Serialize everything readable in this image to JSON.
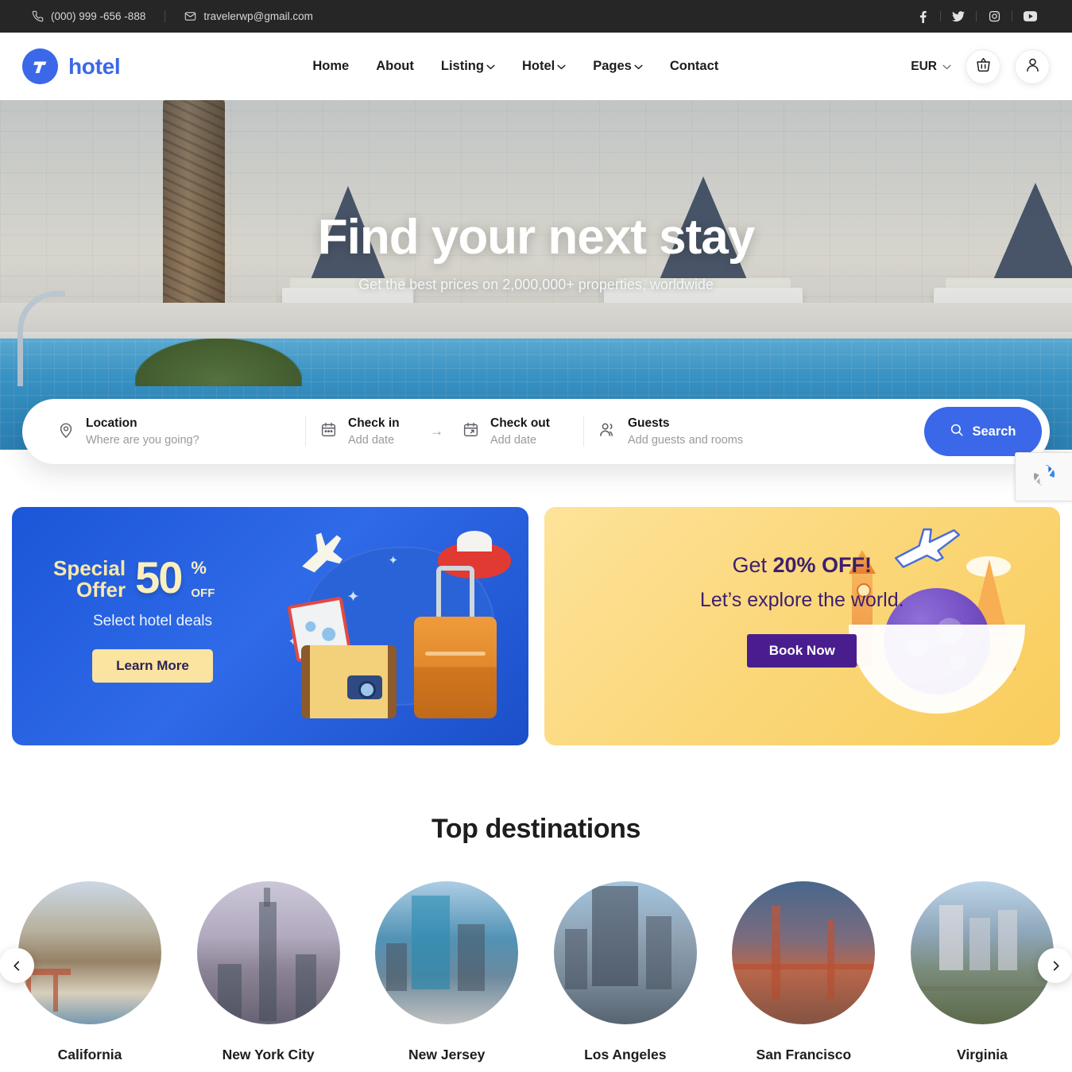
{
  "topbar": {
    "phone": "(000) 999 -656 -888",
    "email": "travelerwp@gmail.com",
    "socials": [
      {
        "name": "facebook-icon",
        "label": "f"
      },
      {
        "name": "twitter-icon",
        "label": "t"
      },
      {
        "name": "instagram-icon",
        "label": "ig"
      },
      {
        "name": "youtube-icon",
        "label": "yt"
      }
    ]
  },
  "header": {
    "brand": "hotel",
    "logo_letter": "T",
    "nav": [
      {
        "label": "Home",
        "caret": false
      },
      {
        "label": "About",
        "caret": false
      },
      {
        "label": "Listing",
        "caret": true
      },
      {
        "label": "Hotel",
        "caret": true
      },
      {
        "label": "Pages",
        "caret": true
      },
      {
        "label": "Contact",
        "caret": false
      }
    ],
    "currency": "EUR",
    "cart_icon": "basket-icon",
    "account_icon": "user-icon"
  },
  "hero": {
    "title": "Find your next stay",
    "subtitle": "Get the best prices on 2,000,000+ properties, worldwide"
  },
  "search": {
    "location_label": "Location",
    "location_placeholder": "Where are you going?",
    "checkin_label": "Check in",
    "checkin_value": "Add date",
    "checkout_label": "Check out",
    "checkout_value": "Add date",
    "guests_label": "Guests",
    "guests_value": "Add guests and rooms",
    "button": "Search",
    "arrow": "→"
  },
  "recaptcha": {
    "icon": "recaptcha-icon"
  },
  "promos": {
    "left": {
      "line1": "Special",
      "line2": "Offer",
      "amount": "50",
      "percent": "%",
      "off": "OFF",
      "subtitle": "Select hotel deals",
      "button": "Learn More"
    },
    "right": {
      "headline_prefix": "Get ",
      "headline_bold": "20% OFF!",
      "subhead": "Let’s explore the world.",
      "button": "Book Now"
    }
  },
  "destinations": {
    "title": "Top destinations",
    "prev": "‹",
    "next": "›",
    "items": [
      {
        "name": "California"
      },
      {
        "name": "New York City"
      },
      {
        "name": "New Jersey"
      },
      {
        "name": "Los Angeles"
      },
      {
        "name": "San Francisco"
      },
      {
        "name": "Virginia"
      }
    ]
  },
  "colors": {
    "accent": "#3b68e8",
    "topbar_bg": "#262626",
    "promo_blue": "#1b56d8",
    "promo_yellow": "#fbd87c",
    "promo_purple": "#4a1d8f"
  }
}
